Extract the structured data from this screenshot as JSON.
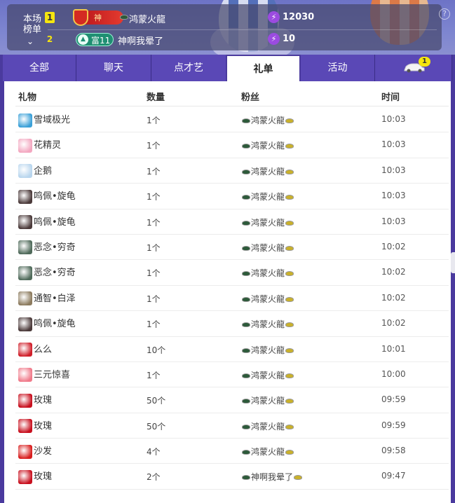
{
  "rank": {
    "title": "本场榜单",
    "entries": [
      {
        "position": "1",
        "badge_label": "神",
        "name": "鸿蒙火龍",
        "bolt_value": "12030"
      },
      {
        "position": "2",
        "badge_label": "富11",
        "name": "神啊我晕了",
        "bolt_value": "10"
      }
    ]
  },
  "tabs": [
    {
      "label": "全部"
    },
    {
      "label": "聊天"
    },
    {
      "label": "点才艺"
    },
    {
      "label": "礼单",
      "active": true
    },
    {
      "label": "活动"
    },
    {
      "label": "",
      "icon": "car-icon",
      "badge": "1"
    }
  ],
  "table": {
    "headers": {
      "gift": "礼物",
      "qty": "数量",
      "fan": "粉丝",
      "time": "时间"
    },
    "rows": [
      {
        "gift": "雪域极光",
        "icon": "aurora-icon",
        "color": "#3aa0d8",
        "qty": "1个",
        "fan": "鸿蒙火龍",
        "time": "10:03"
      },
      {
        "gift": "花精灵",
        "icon": "flower-fairy-icon",
        "color": "#f3a7c0",
        "qty": "1个",
        "fan": "鸿蒙火龍",
        "time": "10:03"
      },
      {
        "gift": "企鹅",
        "icon": "penguin-icon",
        "color": "#b9d6ee",
        "qty": "1个",
        "fan": "鸿蒙火龍",
        "time": "10:03"
      },
      {
        "gift": "鸣佩•旋龟",
        "icon": "turtle-icon",
        "color": "#4b3a3a",
        "qty": "1个",
        "fan": "鸿蒙火龍",
        "time": "10:03"
      },
      {
        "gift": "鸣佩•旋龟",
        "icon": "turtle-icon",
        "color": "#4b3a3a",
        "qty": "1个",
        "fan": "鸿蒙火龍",
        "time": "10:03"
      },
      {
        "gift": "恶念•穷奇",
        "icon": "beast-icon",
        "color": "#4f6a5a",
        "qty": "1个",
        "fan": "鸿蒙火龍",
        "time": "10:02"
      },
      {
        "gift": "恶念•穷奇",
        "icon": "beast-icon",
        "color": "#4f6a5a",
        "qty": "1个",
        "fan": "鸿蒙火龍",
        "time": "10:02"
      },
      {
        "gift": "通智•白泽",
        "icon": "baize-icon",
        "color": "#8c7b5e",
        "qty": "1个",
        "fan": "鸿蒙火龍",
        "time": "10:02"
      },
      {
        "gift": "鸣佩•旋龟",
        "icon": "turtle-icon",
        "color": "#4b3a3a",
        "qty": "1个",
        "fan": "鸿蒙火龍",
        "time": "10:02"
      },
      {
        "gift": "么么",
        "icon": "kiss-icon",
        "color": "#d01f2a",
        "qty": "10个",
        "fan": "鸿蒙火龍",
        "time": "10:01"
      },
      {
        "gift": "三元惊喜",
        "icon": "surprise-icon",
        "color": "#f07a8a",
        "qty": "1个",
        "fan": "鸿蒙火龍",
        "time": "10:00"
      },
      {
        "gift": "玫瑰",
        "icon": "rose-icon",
        "color": "#c8101e",
        "qty": "50个",
        "fan": "鸿蒙火龍",
        "time": "09:59"
      },
      {
        "gift": "玫瑰",
        "icon": "rose-icon",
        "color": "#c8101e",
        "qty": "50个",
        "fan": "鸿蒙火龍",
        "time": "09:59"
      },
      {
        "gift": "沙发",
        "icon": "sofa-icon",
        "color": "#d81e1e",
        "qty": "4个",
        "fan": "鸿蒙火龍",
        "time": "09:58"
      },
      {
        "gift": "玫瑰",
        "icon": "rose-icon",
        "color": "#c8101e",
        "qty": "2个",
        "fan": "神啊我晕了",
        "time": "09:47"
      }
    ]
  }
}
